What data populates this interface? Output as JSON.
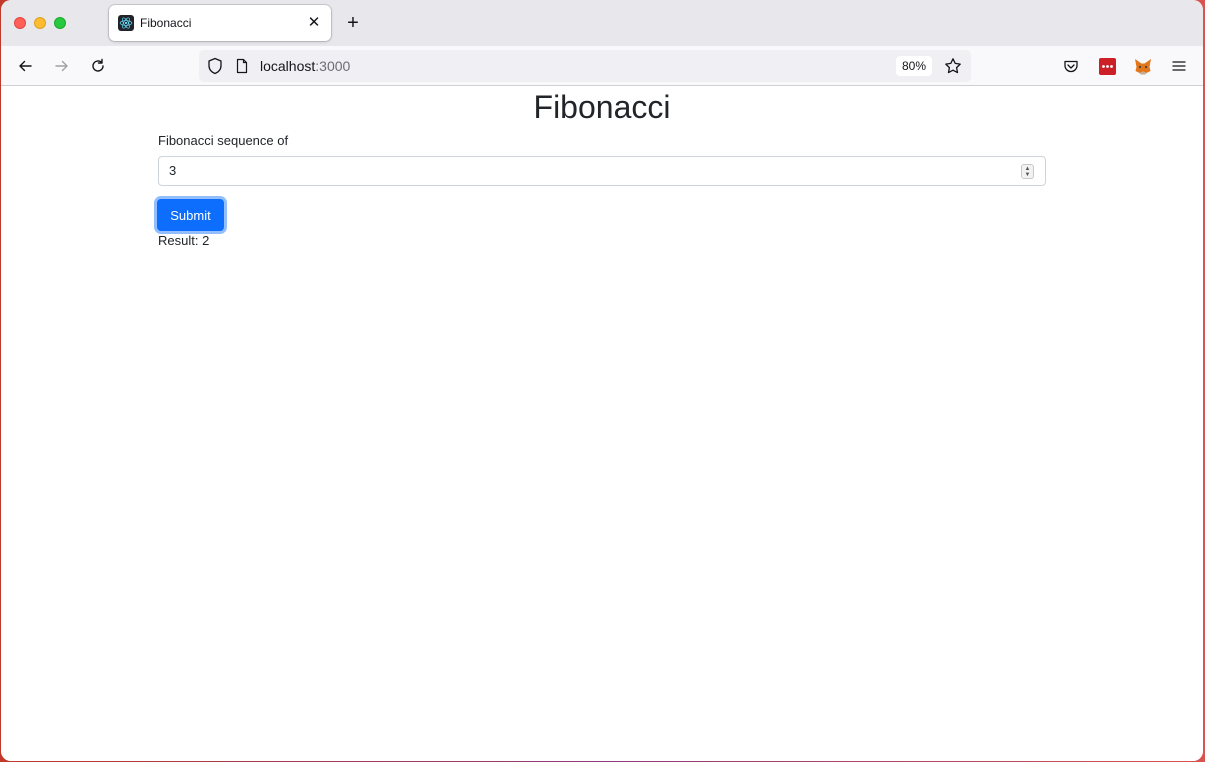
{
  "browser": {
    "tab": {
      "title": "Fibonacci",
      "close_glyph": "✕"
    },
    "new_tab_glyph": "+",
    "url": {
      "host": "localhost",
      "port": ":3000"
    },
    "zoom": "80%"
  },
  "page": {
    "title": "Fibonacci",
    "field_label": "Fibonacci sequence of",
    "input_value": "3",
    "submit_label": "Submit",
    "result_text": "Result: 2"
  },
  "colors": {
    "accent": "#0d6efd",
    "tab_strip": "#e8e7ec",
    "toolbar": "#f9f9fb"
  },
  "icons": [
    "back-icon",
    "forward-icon",
    "reload-icon",
    "shield-icon",
    "page-icon",
    "bookmark-star-icon",
    "pocket-icon",
    "lastpass-icon",
    "metamask-icon",
    "menu-icon",
    "react-icon"
  ]
}
